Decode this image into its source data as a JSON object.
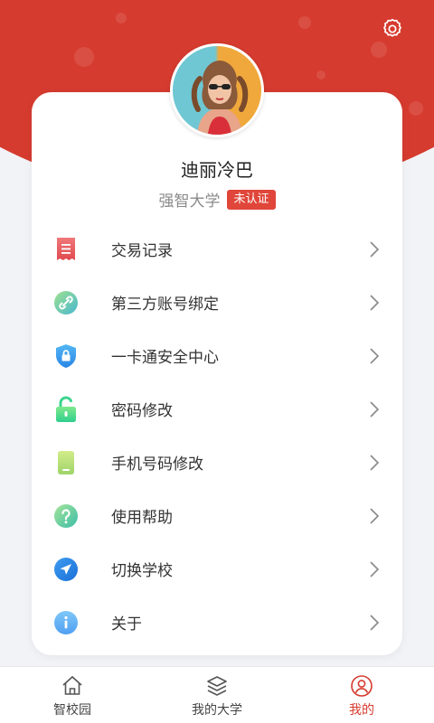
{
  "colors": {
    "brand": "#d63b2f",
    "badge": "#e0463a"
  },
  "header": {
    "settings_icon": "gear-icon"
  },
  "profile": {
    "name": "迪丽冷巴",
    "school": "强智大学",
    "verify_badge": "未认证"
  },
  "menu": [
    {
      "label": "交易记录",
      "icon": "receipt-icon"
    },
    {
      "label": "第三方账号绑定",
      "icon": "link-icon"
    },
    {
      "label": "一卡通安全中心",
      "icon": "shield-lock-icon"
    },
    {
      "label": "密码修改",
      "icon": "unlock-icon"
    },
    {
      "label": "手机号码修改",
      "icon": "phone-icon"
    },
    {
      "label": "使用帮助",
      "icon": "help-icon"
    },
    {
      "label": "切换学校",
      "icon": "navigation-icon"
    },
    {
      "label": "关于",
      "icon": "info-icon"
    }
  ],
  "tabbar": {
    "active": "我的",
    "tabs": [
      {
        "label": "智校园",
        "icon": "home-icon"
      },
      {
        "label": "我的大学",
        "icon": "layers-icon"
      },
      {
        "label": "我的",
        "icon": "user-icon"
      }
    ]
  }
}
